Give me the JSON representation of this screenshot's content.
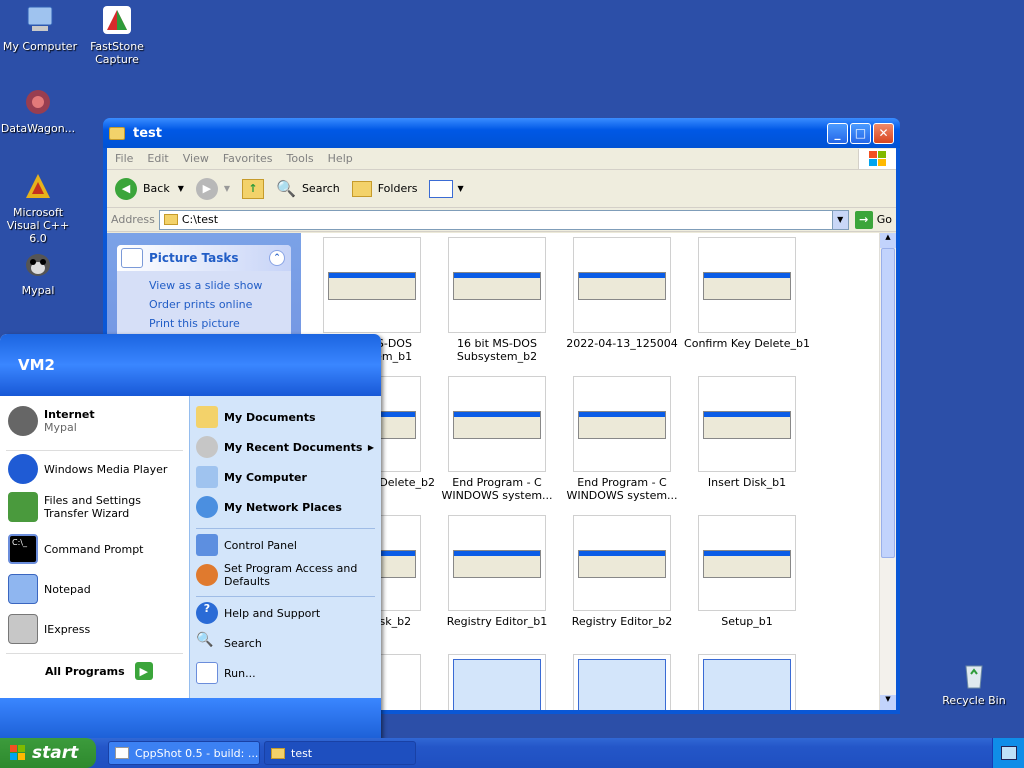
{
  "desktop": {
    "icons": [
      {
        "label": "My Computer",
        "icon": "computer-icon"
      },
      {
        "label": "FastStone Capture",
        "icon": "faststone-icon"
      },
      {
        "label": "DataWagon...",
        "icon": "datawagon-icon"
      },
      {
        "label": "Microsoft Visual C++ 6.0",
        "icon": "visual-cpp-icon"
      },
      {
        "label": "Mypal",
        "icon": "mypal-icon"
      },
      {
        "label": "Recycle Bin",
        "icon": "recycle-bin-icon"
      }
    ]
  },
  "window": {
    "title": "test",
    "menu": [
      "File",
      "Edit",
      "View",
      "Favorites",
      "Tools",
      "Help"
    ],
    "toolbar": {
      "back": "Back",
      "search": "Search",
      "folders": "Folders"
    },
    "address": {
      "label": "Address",
      "value": "C:\\test",
      "go": "Go"
    },
    "tasks": {
      "title": "Picture Tasks",
      "items": [
        "View as a slide show",
        "Order prints online",
        "Print this picture"
      ]
    },
    "files": [
      {
        "caption": "16 bit MS-DOS Subsystem_b1"
      },
      {
        "caption": "16 bit MS-DOS Subsystem_b2"
      },
      {
        "caption": "2022-04-13_125004"
      },
      {
        "caption": "Confirm Key Delete_b1"
      },
      {
        "caption": "Confirm Key Delete_b2"
      },
      {
        "caption": "End Program - C WINDOWS system..."
      },
      {
        "caption": "End Program - C WINDOWS system..."
      },
      {
        "caption": "Insert Disk_b1"
      },
      {
        "caption": "Insert Disk_b2"
      },
      {
        "caption": "Registry Editor_b1"
      },
      {
        "caption": "Registry Editor_b2"
      },
      {
        "caption": "Setup_b1"
      }
    ]
  },
  "start_menu": {
    "user": "VM2",
    "pinned": [
      {
        "title": "Internet",
        "subtitle": "Mypal"
      }
    ],
    "left": [
      "Windows Media Player",
      "Files and Settings Transfer Wizard",
      "Command Prompt",
      "Notepad",
      "IExpress"
    ],
    "all_programs": "All Programs",
    "right": [
      "My Documents",
      "My Recent Documents",
      "My Computer",
      "My Network Places",
      "Control Panel",
      "Set Program Access and Defaults",
      "Help and Support",
      "Search",
      "Run..."
    ]
  },
  "taskbar": {
    "start": "start",
    "tasks": [
      "CppShot 0.5 - build: ...",
      "test"
    ]
  },
  "colors": {
    "desktop": "#2c4fa8",
    "xp_blue": "#0a57d6",
    "start_green": "#3c9b3c"
  }
}
